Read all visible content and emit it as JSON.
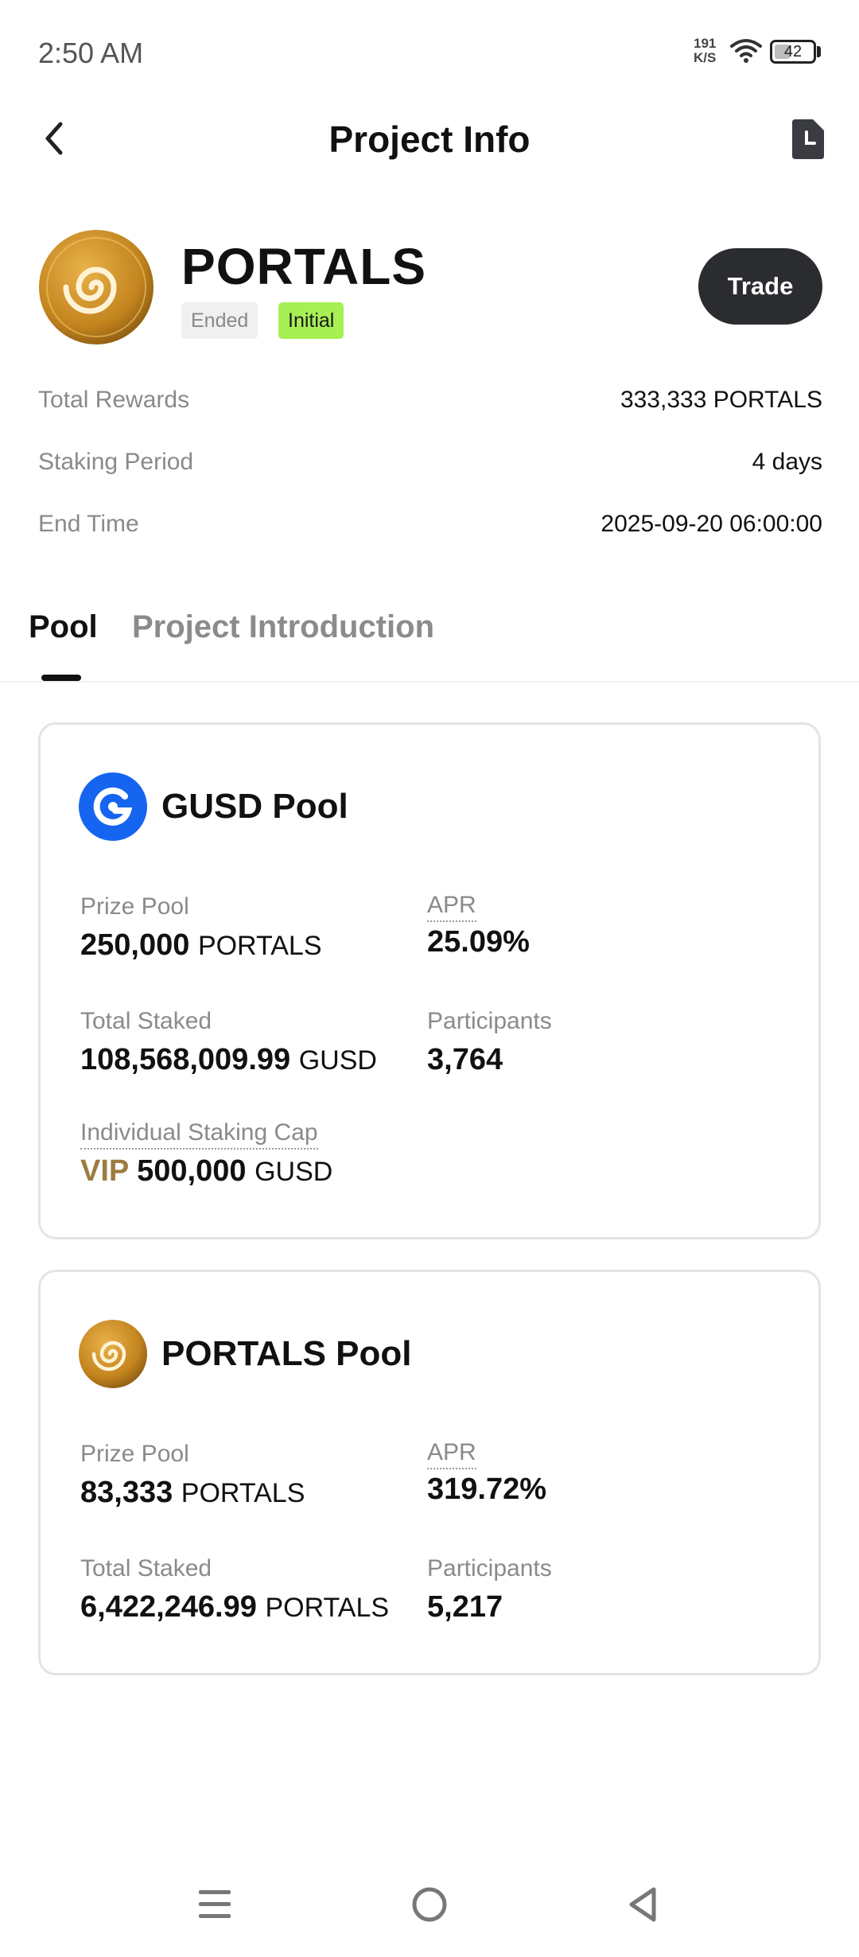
{
  "status_bar": {
    "time": "2:50 AM",
    "net_speed_value": "191",
    "net_speed_unit": "K/S",
    "battery": "42",
    "battery_level": 0.42
  },
  "header": {
    "title": "Project Info",
    "back_icon": "back-arrow-icon",
    "history_icon": "document-clock-icon"
  },
  "project": {
    "name": "PORTALS",
    "badges": [
      "Ended",
      "Initial"
    ],
    "trade_label": "Trade",
    "info": [
      {
        "label": "Total Rewards",
        "value": "333,333 PORTALS"
      },
      {
        "label": "Staking Period",
        "value": "4 days"
      },
      {
        "label": "End Time",
        "value": "2025-09-20 06:00:00"
      }
    ]
  },
  "tabs": [
    {
      "label": "Pool",
      "active": true
    },
    {
      "label": "Project Introduction",
      "active": false
    }
  ],
  "pools": [
    {
      "title": "GUSD Pool",
      "icon": "gusd-logo-icon",
      "prize_pool_label": "Prize Pool",
      "prize_pool_value": "250,000",
      "prize_pool_unit": "PORTALS",
      "apr_label": "APR",
      "apr_value": "25.09%",
      "total_staked_label": "Total Staked",
      "total_staked_value": "108,568,009.99",
      "total_staked_unit": "GUSD",
      "participants_label": "Participants",
      "participants_value": "3,764",
      "cap_label": "Individual Staking Cap",
      "cap_prefix": "VIP",
      "cap_value": "500,000",
      "cap_unit": "GUSD"
    },
    {
      "title": "PORTALS Pool",
      "icon": "portals-logo-icon",
      "prize_pool_label": "Prize Pool",
      "prize_pool_value": "83,333",
      "prize_pool_unit": "PORTALS",
      "apr_label": "APR",
      "apr_value": "319.72%",
      "total_staked_label": "Total Staked",
      "total_staked_value": "6,422,246.99",
      "total_staked_unit": "PORTALS",
      "participants_label": "Participants",
      "participants_value": "5,217"
    }
  ],
  "nav_bar": {
    "menu_icon": "menu-icon",
    "home_icon": "home-circle-icon",
    "back_icon": "back-triangle-icon"
  },
  "colors": {
    "accent_badge": "#a6ef55",
    "trade_button": "#2b2c30",
    "vip": "#9c7c40",
    "gusd_blue": "#1565f0"
  }
}
